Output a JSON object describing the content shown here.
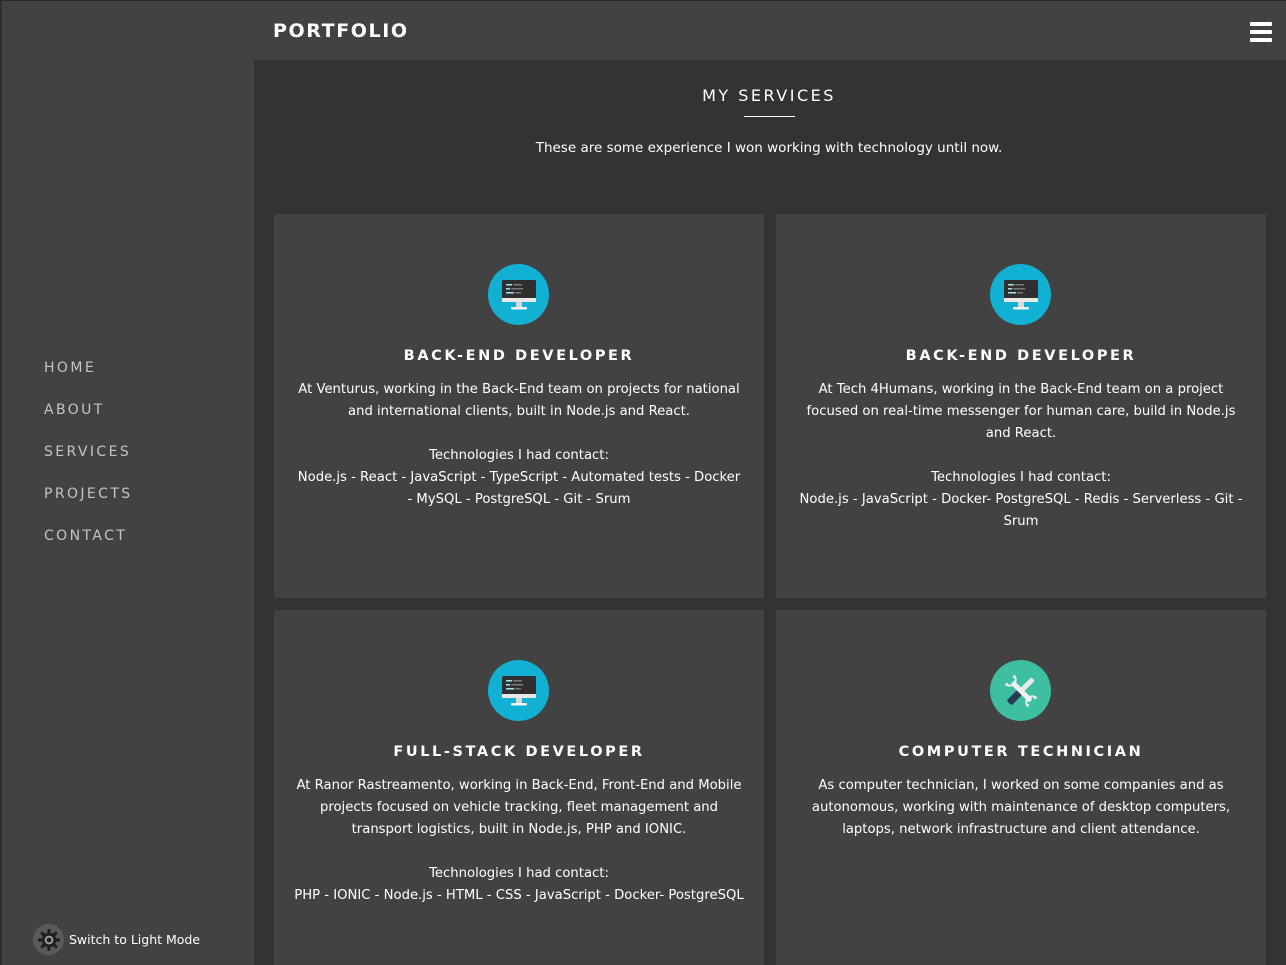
{
  "header": {
    "brand": "PORTFOLIO",
    "menu_icon": "hamburger-menu-icon"
  },
  "sidebar": {
    "items": [
      {
        "label": "HOME"
      },
      {
        "label": "ABOUT"
      },
      {
        "label": "SERVICES"
      },
      {
        "label": "PROJECTS"
      },
      {
        "label": "CONTACT"
      }
    ],
    "mode_toggle": {
      "icon": "gear-icon",
      "label": "Switch to Light Mode"
    }
  },
  "services": {
    "title": "MY SERVICES",
    "subtitle": "These are some experience I won working with technology until now.",
    "cards": [
      {
        "icon": "monitor-icon",
        "title": "BACK-END DEVELOPER",
        "description": "At Venturus, working in the Back-End team on projects for national and international clients, built in Node.js and React.",
        "tech_label": "Technologies I had contact:",
        "technologies": "Node.js - React - JavaScript - TypeScript - Automated tests - Docker - MySQL - PostgreSQL - Git - Srum"
      },
      {
        "icon": "monitor-icon",
        "title": "BACK-END DEVELOPER",
        "description": "At Tech 4Humans, working in the Back-End team on a project focused on real-time messenger for human care, build in Node.js and React.",
        "tech_label": "Technologies I had contact:",
        "technologies": "Node.js - JavaScript - Docker- PostgreSQL - Redis - Serverless - Git - Srum"
      },
      {
        "icon": "monitor-icon",
        "title": "FULL-STACK DEVELOPER",
        "description": "At Ranor Rastreamento, working in Back-End, Front-End and Mobile projects focused on vehicle tracking, fleet management and transport logistics, built in Node.js, PHP and IONIC.",
        "tech_label": "Technologies I had contact:",
        "technologies": "PHP - IONIC - Node.js - HTML - CSS - JavaScript - Docker- PostgreSQL"
      },
      {
        "icon": "tools-icon",
        "title": "COMPUTER TECHNICIAN",
        "description": "As computer technician, I worked on some companies and as autonomous, working with maintenance of desktop computers, laptops, network infrastructure and client attendance."
      }
    ]
  },
  "colors": {
    "sidebar_bg": "#424242",
    "main_bg": "#333333",
    "card_bg": "#424242",
    "icon_blue": "#12b0d3",
    "icon_green": "#3fbfa2"
  }
}
